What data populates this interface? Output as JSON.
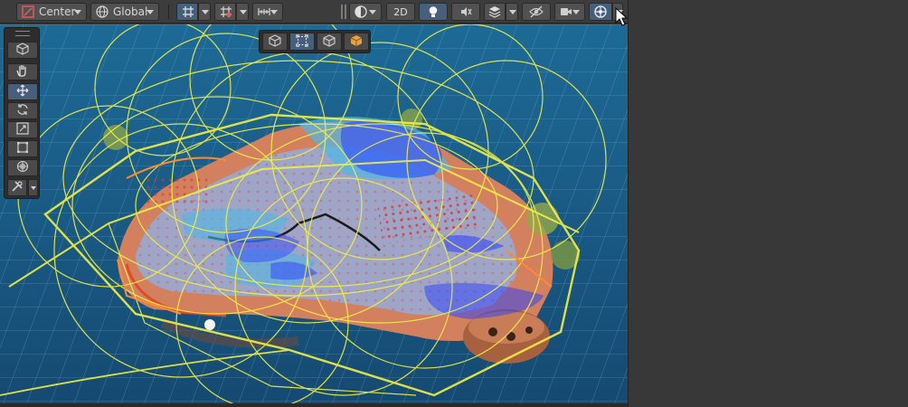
{
  "toolbar": {
    "pivot_mode_label": "Center",
    "pivot_rotation_label": "Global",
    "mode_2d_label": "2D",
    "accent_color": "#46607c"
  },
  "icons": {
    "pivot_mode": "pivot-center-icon",
    "pivot_rotation": "globe-icon",
    "grid_snapping": "grid-snap-icon",
    "increment_snap": "increment-snap-icon",
    "ruler": "ruler-icon",
    "shading": "shading-sphere-icon",
    "lighting": "light-bulb-icon",
    "audio": "audio-mute-icon",
    "effects": "effects-layers-icon",
    "visibility": "scene-visibility-icon",
    "camera": "camera-icon",
    "gizmos": "gizmos-icon"
  },
  "tools": [
    "view-tool",
    "hand-tool",
    "move-tool",
    "rotate-tool",
    "scale-tool",
    "rect-tool",
    "transform-tool",
    "custom-tool"
  ],
  "view_modes": [
    "wireframe-cube",
    "rect-frame",
    "cube-outline",
    "cube-solid-orange"
  ],
  "colors": {
    "water": "#1b5a86",
    "gizmo_yellow": "#f2f046",
    "gizmo_blue": "#2b40ff",
    "terrain_orange": "#d2805e",
    "floor_lavender": "#9ea5c6"
  }
}
